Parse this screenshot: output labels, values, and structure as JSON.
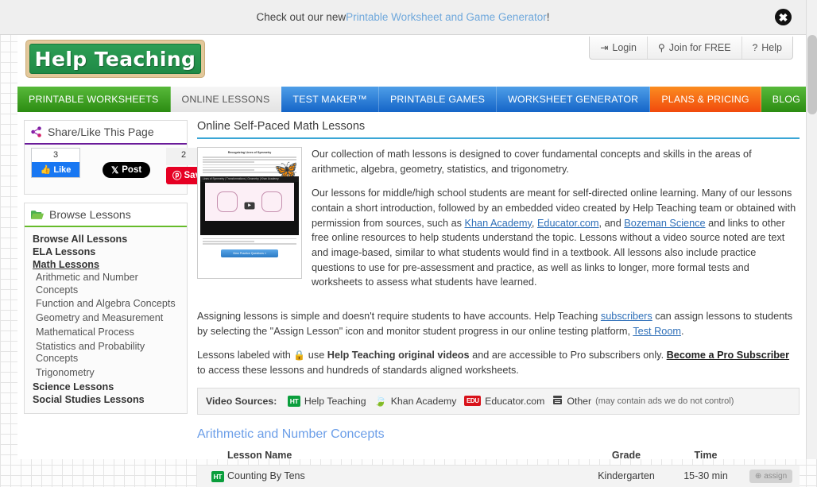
{
  "promo": {
    "text_before": "Check out our new ",
    "link": "Printable Worksheet and Game Generator",
    "text_after": "!",
    "close_label": "✖"
  },
  "header": {
    "logo_text": "Help Teaching",
    "account_buttons": [
      {
        "label": "Login",
        "icon": "login-icon",
        "glyph": "⇥"
      },
      {
        "label": "Join for FREE",
        "icon": "person-icon",
        "glyph": "⚲"
      },
      {
        "label": "Help",
        "icon": "question-circle-icon",
        "glyph": "?"
      }
    ]
  },
  "nav": [
    {
      "label": "PRINTABLE WORKSHEETS",
      "style": "green",
      "active": false
    },
    {
      "label": "ONLINE LESSONS",
      "style": "active",
      "active": true
    },
    {
      "label": "TEST MAKER™",
      "style": "blue",
      "active": false
    },
    {
      "label": "PRINTABLE GAMES",
      "style": "blue",
      "active": false
    },
    {
      "label": "WORKSHEET GENERATOR",
      "style": "blue",
      "active": false
    },
    {
      "label": "PLANS & PRICING",
      "style": "orange",
      "active": false
    },
    {
      "label": "BLOG",
      "style": "blog",
      "active": false
    }
  ],
  "sidebar": {
    "share_panel": {
      "title": "Share/Like This Page",
      "icon": "share-icon",
      "facebook": {
        "count": "3",
        "label": "Like",
        "icon": "thumbs-up-icon"
      },
      "x_post": {
        "label": "Post",
        "icon": "x-logo-icon"
      },
      "pinterest": {
        "count": "2",
        "label": "Save",
        "icon": "pinterest-icon"
      }
    },
    "browse_panel": {
      "title": "Browse Lessons",
      "icon": "folder-icon",
      "items": [
        {
          "label": "Browse All Lessons",
          "level": 1,
          "current": false
        },
        {
          "label": "ELA Lessons",
          "level": 1,
          "current": false
        },
        {
          "label": "Math Lessons",
          "level": 1,
          "current": true
        },
        {
          "label": "Arithmetic and Number Concepts",
          "level": 2,
          "current": false
        },
        {
          "label": "Function and Algebra Concepts",
          "level": 2,
          "current": false
        },
        {
          "label": "Geometry and Measurement",
          "level": 2,
          "current": false
        },
        {
          "label": "Mathematical Process",
          "level": 2,
          "current": false
        },
        {
          "label": "Statistics and Probability Concepts",
          "level": 2,
          "current": false
        },
        {
          "label": "Trigonometry",
          "level": 2,
          "current": false
        },
        {
          "label": "Science Lessons",
          "level": 1,
          "current": false
        },
        {
          "label": "Social Studies Lessons",
          "level": 1,
          "current": false
        }
      ]
    }
  },
  "content": {
    "title": "Online Self-Paced Math Lessons",
    "thumbnail": {
      "title": "Recognizing Lines of Symmetry",
      "video_bar": "Lines of Symmetry | Transformations | Geometry | Khan Academy",
      "button": "View Practice Questions »"
    },
    "paragraph1": "Our collection of math lessons is designed to cover fundamental concepts and skills in the areas of arithmetic, algebra, geometry, statistics, and trigonometry.",
    "paragraph2_a": "Our lessons for middle/high school students are meant for self-directed online learning. Many of our lessons contain a short introduction, followed by an embedded video created by Help Teaching team or obtained with permission from sources, such as ",
    "link_khan": "Khan Academy",
    "paragraph2_b": ", ",
    "link_educator": "Educator.com",
    "paragraph2_c": ", and ",
    "link_bozeman": "Bozeman Science",
    "paragraph2_d": " and links to other free online resources to help students understand the topic. Lessons without a video source noted are text and image-based, similar to what students would find in a textbook. All lessons also include practice questions to use for pre-assessment and practice, as well as links to longer, more formal tests and worksheets to assess what students have learned.",
    "paragraph3_a": "Assigning lessons is simple and doesn't require students to have accounts. Help Teaching ",
    "link_subscribers": "subscribers",
    "paragraph3_b": " can assign lessons to students by selecting the \"Assign Lesson\" icon and monitor student progress in our online testing platform, ",
    "link_testroom": "Test Room",
    "paragraph3_c": ".",
    "paragraph4_a": "Lessons labeled with ",
    "lock_icon": "🔒",
    "paragraph4_b": " use ",
    "paragraph4_bold": "Help Teaching original videos",
    "paragraph4_c": " and are accessible to Pro subscribers only. ",
    "link_pro": "Become a Pro Subscriber",
    "paragraph4_d": " to access these lessons and hundreds of standards aligned worksheets.",
    "video_sources": {
      "label": "Video Sources:",
      "items": [
        {
          "badge": "HT",
          "badge_type": "ht",
          "label": "Help Teaching",
          "note": ""
        },
        {
          "badge": "🍃",
          "badge_type": "ka",
          "label": "Khan Academy",
          "note": ""
        },
        {
          "badge": "EDU",
          "badge_type": "edu",
          "label": "Educator.com",
          "note": ""
        },
        {
          "badge": "▤",
          "badge_type": "yt",
          "label": "Other",
          "note": "(may contain ads we do not control)"
        }
      ]
    },
    "section_title": "Arithmetic and Number Concepts",
    "table": {
      "headers": [
        "Lesson Name",
        "Grade",
        "Time",
        ""
      ],
      "rows": [
        {
          "badge": "HT",
          "name": "Counting By Tens",
          "grade": "Kindergarten",
          "time": "15-30 min",
          "action": "assign"
        }
      ]
    }
  }
}
